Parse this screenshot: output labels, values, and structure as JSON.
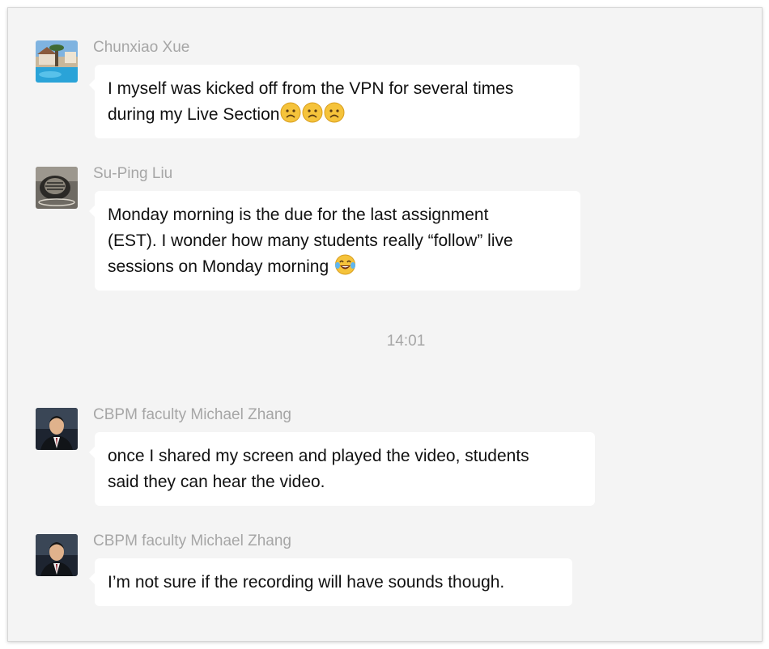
{
  "messages": [
    {
      "sender": "Chunxiao Xue",
      "avatar_icon": "resort-pool-photo-avatar",
      "lines": [
        "I myself was kicked off from the VPN for several times",
        "during my Live Section"
      ],
      "emojis": [
        "sad-face-emoji",
        "sad-face-emoji",
        "sad-face-emoji"
      ]
    },
    {
      "sender": "Su-Ping Liu",
      "avatar_icon": "speaker-photo-avatar",
      "lines": [
        "Monday morning is the due for the last assignment",
        "(EST). I wonder how many students really “follow” live",
        "sessions on Monday morning"
      ],
      "emojis": [
        "tears-of-joy-emoji"
      ]
    },
    {
      "sender": "CBPM faculty Michael Zhang",
      "avatar_icon": "portrait-photo-avatar",
      "lines": [
        "once I shared my screen and played the video, students",
        "said they can hear the video."
      ]
    },
    {
      "sender": "CBPM faculty Michael Zhang",
      "avatar_icon": "portrait-photo-avatar",
      "lines": [
        "I’m not sure if the recording will have sounds though."
      ]
    }
  ],
  "timestamp": "14:01",
  "colors": {
    "background": "#f4f4f4",
    "bubble": "#ffffff",
    "sender_text": "#a6a6a6",
    "message_text": "#111111"
  }
}
